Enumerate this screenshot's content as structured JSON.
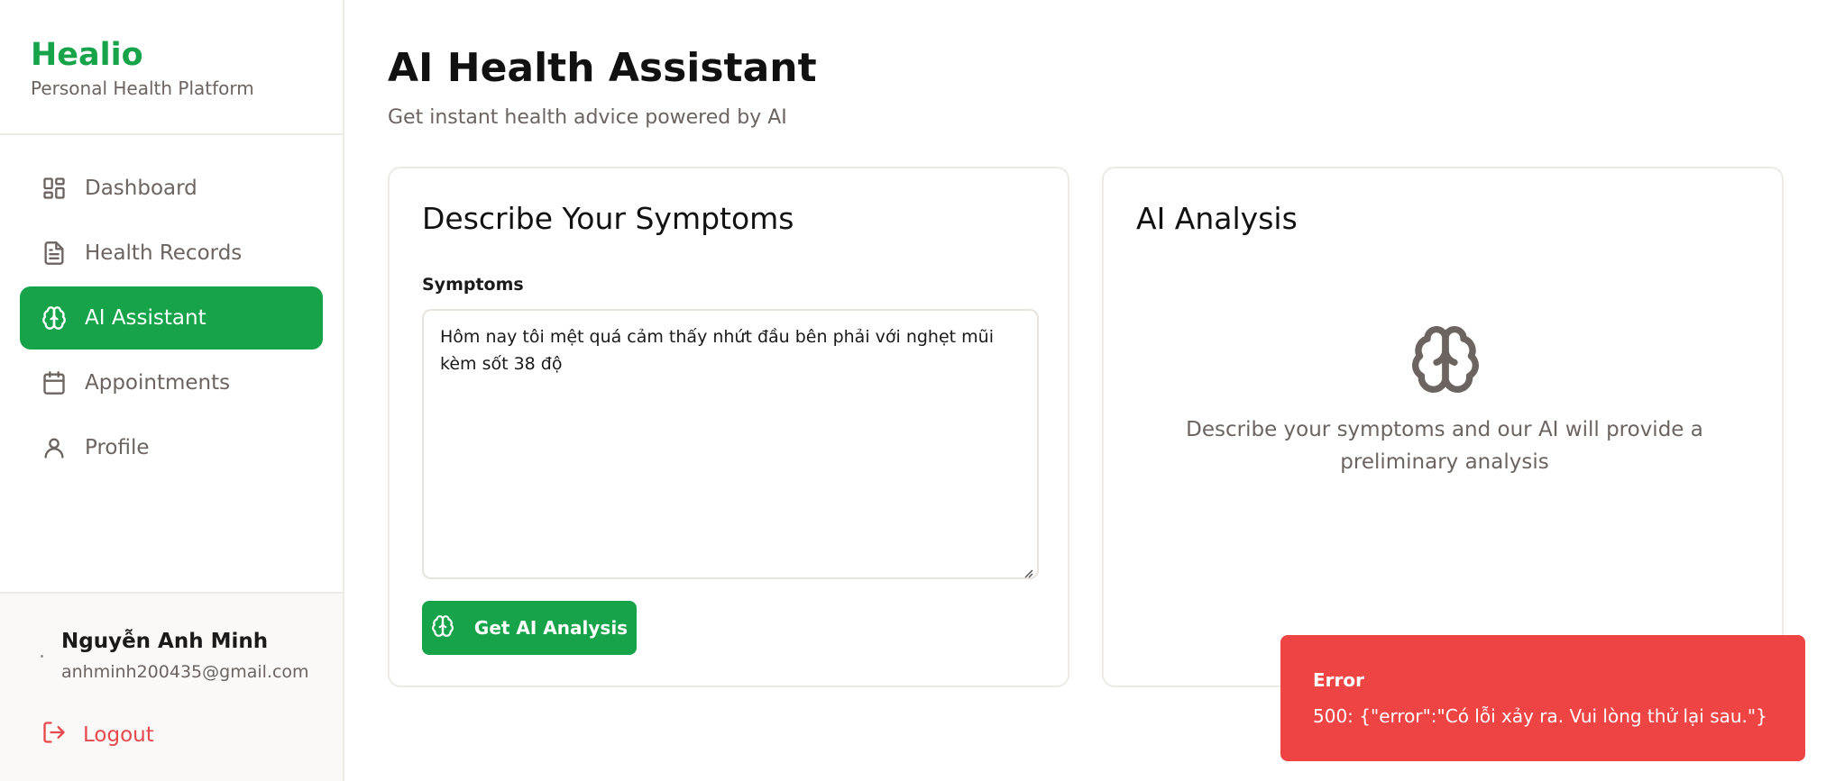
{
  "brand": {
    "name": "Healio",
    "subtitle": "Personal Health Platform"
  },
  "sidebar": {
    "items": [
      {
        "label": "Dashboard",
        "icon": "layout-grid-icon",
        "active": false
      },
      {
        "label": "Health Records",
        "icon": "file-text-icon",
        "active": false
      },
      {
        "label": "AI Assistant",
        "icon": "brain-icon",
        "active": true
      },
      {
        "label": "Appointments",
        "icon": "calendar-icon",
        "active": false
      },
      {
        "label": "Profile",
        "icon": "user-icon",
        "active": false
      }
    ]
  },
  "user": {
    "name": "Nguyễn Anh Minh",
    "email": "anhminh200435@gmail.com"
  },
  "logout": {
    "label": "Logout",
    "icon": "logout-icon"
  },
  "page": {
    "title": "AI Health Assistant",
    "subtitle": "Get instant health advice powered by AI"
  },
  "symptoms_card": {
    "title": "Describe Your Symptoms",
    "field_label": "Symptoms",
    "value": "Hôm nay tôi mệt quá cảm thấy nhứt đầu bên phải với nghẹt mũi kèm sốt 38 độ",
    "button_label": "Get AI Analysis"
  },
  "analysis_card": {
    "title": "AI Analysis",
    "hint": "Describe your symptoms and our AI will provide a preliminary analysis"
  },
  "toast": {
    "title": "Error",
    "message": "500: {\"error\":\"Có lỗi xảy ra. Vui lòng thử lại sau.\"}"
  },
  "colors": {
    "accent": "#16a34a",
    "error": "#ef4444",
    "logout": "#e5484d",
    "muted": "#6b6460"
  }
}
